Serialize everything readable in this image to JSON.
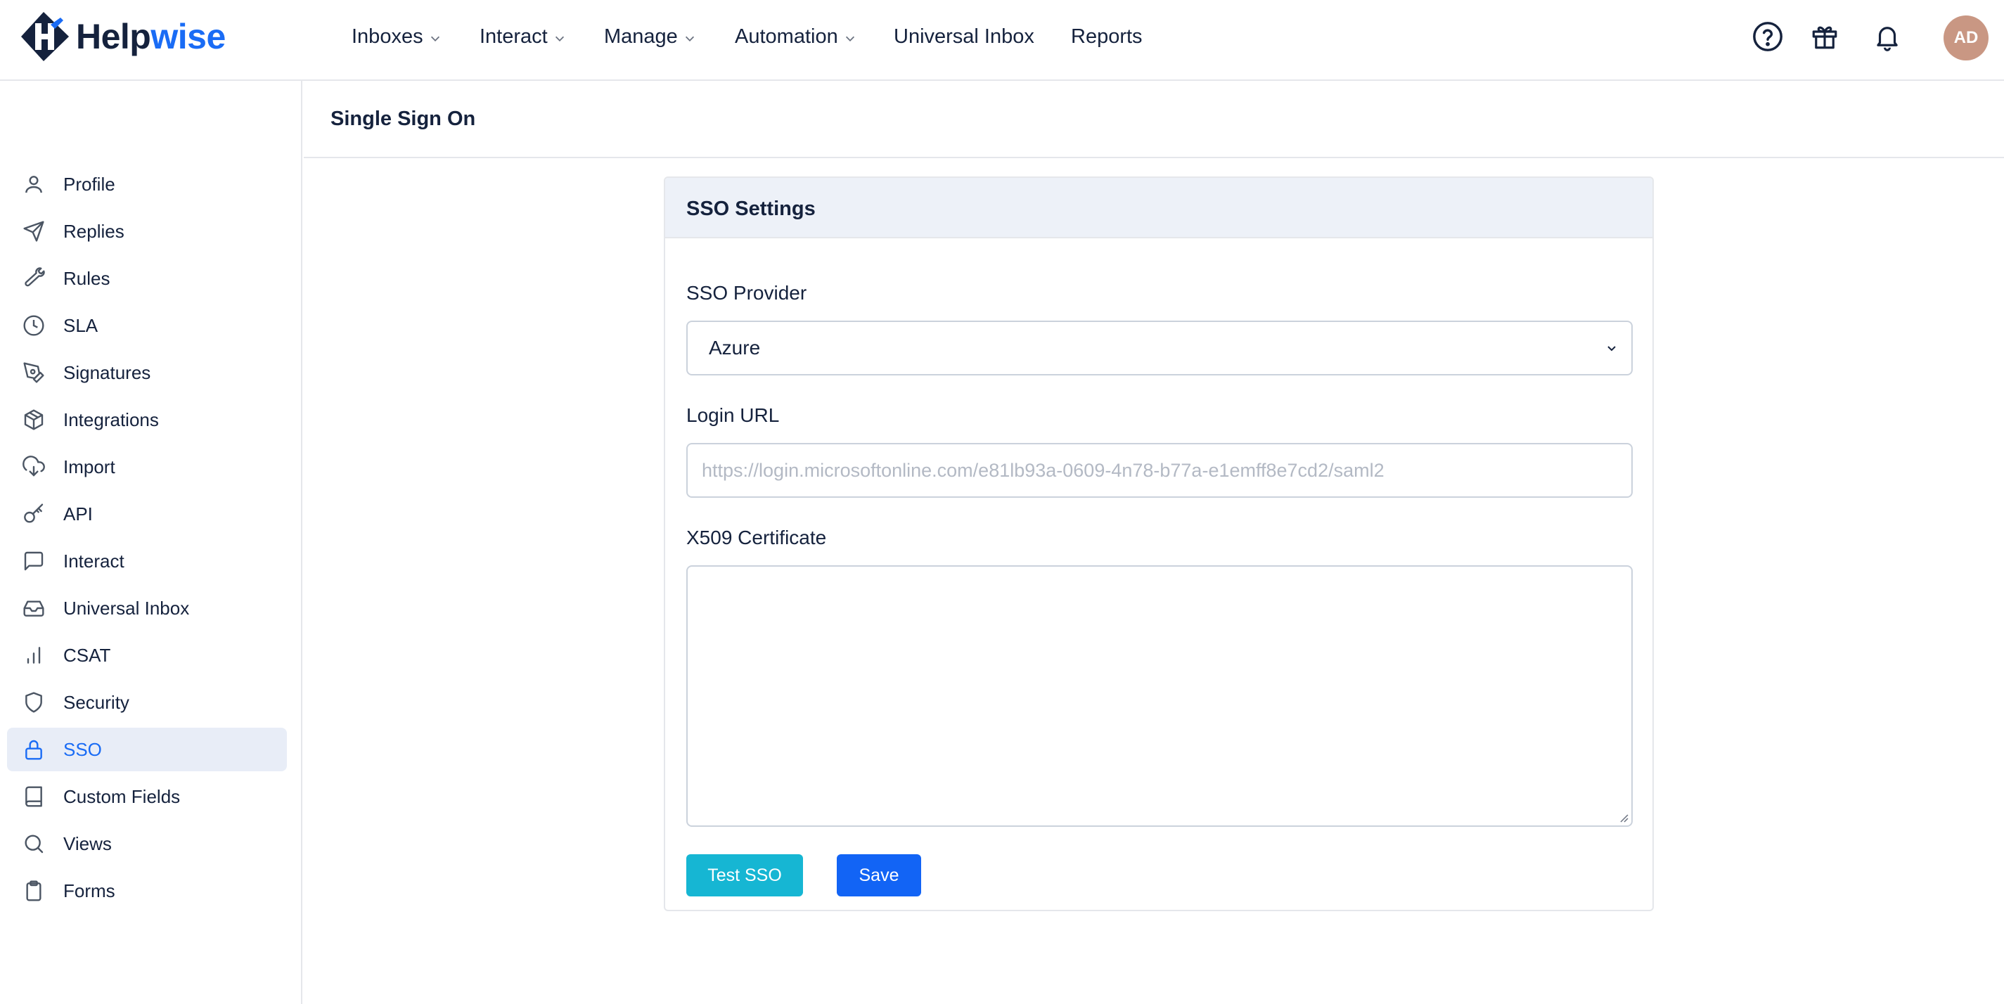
{
  "brand": {
    "name_part1": "Help",
    "name_part2": "wise"
  },
  "nav": {
    "items": [
      {
        "label": "Inboxes",
        "has_dropdown": true
      },
      {
        "label": "Interact",
        "has_dropdown": true
      },
      {
        "label": "Manage",
        "has_dropdown": true
      },
      {
        "label": "Automation",
        "has_dropdown": true
      },
      {
        "label": "Universal Inbox",
        "has_dropdown": false
      },
      {
        "label": "Reports",
        "has_dropdown": false
      }
    ],
    "icons": [
      "help-circle-icon",
      "gift-icon",
      "bell-icon"
    ],
    "avatar_initials": "AD"
  },
  "sidebar": {
    "active": "SSO",
    "items": [
      {
        "label": "Profile",
        "icon": "user-icon"
      },
      {
        "label": "Replies",
        "icon": "send-icon"
      },
      {
        "label": "Rules",
        "icon": "wrench-icon"
      },
      {
        "label": "SLA",
        "icon": "clock-icon"
      },
      {
        "label": "Signatures",
        "icon": "pen-tool-icon"
      },
      {
        "label": "Integrations",
        "icon": "package-icon"
      },
      {
        "label": "Import",
        "icon": "cloud-download-icon"
      },
      {
        "label": "API",
        "icon": "key-icon"
      },
      {
        "label": "Interact",
        "icon": "message-square-icon"
      },
      {
        "label": "Universal Inbox",
        "icon": "inbox-icon"
      },
      {
        "label": "CSAT",
        "icon": "bar-chart-icon"
      },
      {
        "label": "Security",
        "icon": "shield-icon"
      },
      {
        "label": "SSO",
        "icon": "lock-icon"
      },
      {
        "label": "Custom Fields",
        "icon": "book-icon"
      },
      {
        "label": "Views",
        "icon": "search-icon"
      },
      {
        "label": "Forms",
        "icon": "clipboard-icon"
      }
    ]
  },
  "page": {
    "title": "Single Sign On"
  },
  "sso_card": {
    "title": "SSO Settings",
    "provider_label": "SSO Provider",
    "provider_value": "Azure",
    "login_url_label": "Login URL",
    "login_url_placeholder": "https://login.microsoftonline.com/e81lb93a-0609-4n78-b77a-e1emff8e7cd2/saml2",
    "certificate_label": "X509 Certificate",
    "certificate_value": "",
    "test_button": "Test SSO",
    "save_button": "Save"
  },
  "colors": {
    "brand_dark": "#15223d",
    "brand_blue": "#1a6cf5",
    "active_bg": "#e8edf7",
    "test_button": "#16b6d3",
    "save_button": "#1264f5",
    "avatar_bg": "#c99783"
  }
}
